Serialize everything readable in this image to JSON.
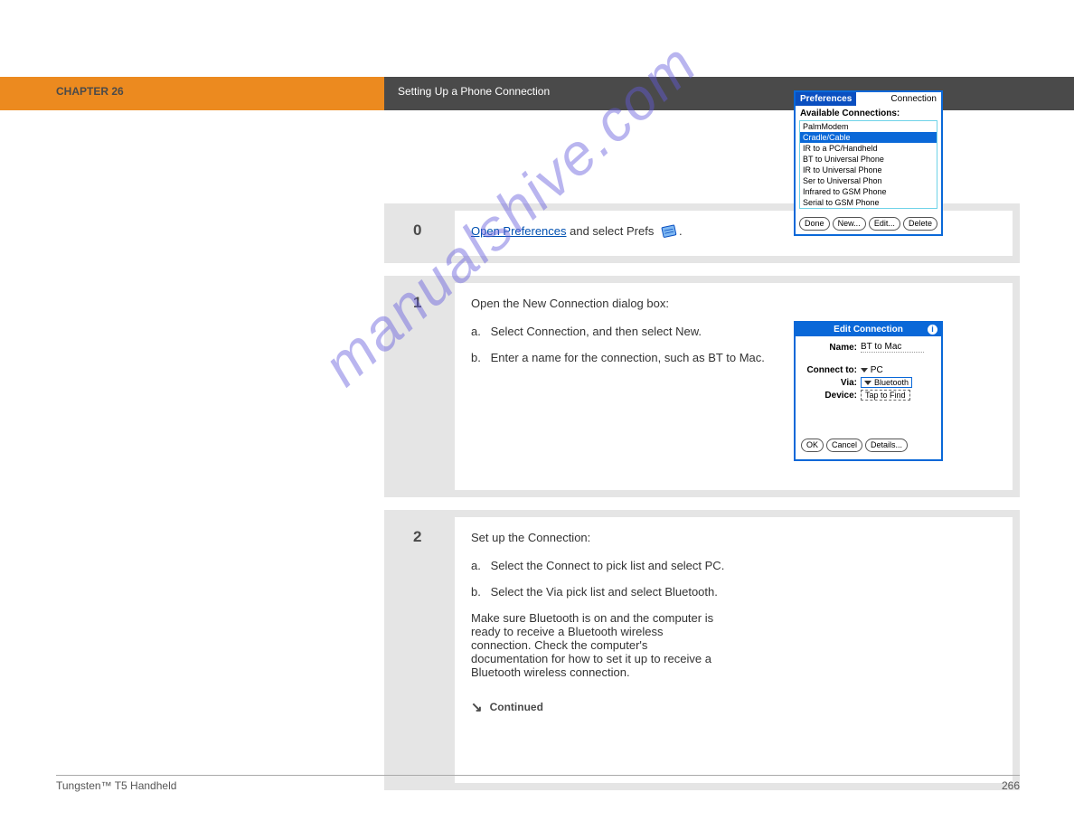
{
  "header": {
    "chapter": "CHAPTER 26",
    "section": "Setting Up a Phone Connection"
  },
  "step0": {
    "num": "0",
    "link": "Open Preferences",
    "rest": " and select Prefs ",
    "tail": "."
  },
  "step1": {
    "num": "1",
    "intro": "Open the New Connection dialog box:",
    "a_lbl": "a.",
    "a_txt": "Select Connection, and then select New.",
    "b_lbl": "b.",
    "b_txt": "Enter a name for the connection, such as BT to Mac."
  },
  "step2": {
    "num": "2",
    "intro": "Set up the Connection:",
    "a_lbl": "a.",
    "a_txt": "Select the Connect to pick list and select PC.",
    "b_lbl": "b.",
    "b_txt": "Select the Via pick list and select Bluetooth.",
    "note": "Make sure Bluetooth is on and the computer is ready to receive a Bluetooth wireless connection. Check the computer's documentation for how to set it up to receive a Bluetooth wireless connection.",
    "continued": "Continued"
  },
  "pda1": {
    "title": "Preferences",
    "tab": "Connection",
    "section": "Available Connections:",
    "items": [
      "PalmModem",
      "Cradle/Cable",
      "IR to a PC/Handheld",
      "BT to Universal Phone",
      "IR to Universal Phone",
      "Ser to Universal Phon",
      "Infrared to GSM Phone",
      "Serial to GSM Phone"
    ],
    "buttons": [
      "Done",
      "New...",
      "Edit...",
      "Delete"
    ]
  },
  "pda2": {
    "title": "Edit Connection",
    "name_lbl": "Name:",
    "name_val": "BT to Mac",
    "connect_lbl": "Connect to:",
    "connect_val": "PC",
    "via_lbl": "Via:",
    "via_val": "Bluetooth",
    "device_lbl": "Device:",
    "device_val": "Tap to Find",
    "buttons": [
      "OK",
      "Cancel",
      "Details..."
    ]
  },
  "footer": {
    "left": "Tungsten™ T5 Handheld",
    "right": "266"
  },
  "watermark": "manualshive.com"
}
